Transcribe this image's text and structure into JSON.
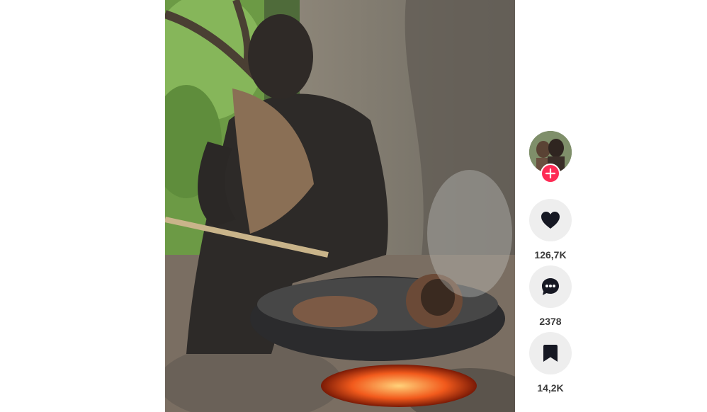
{
  "video": {
    "description_icon": "video-player"
  },
  "sidebar": {
    "avatar_icon": "creator-avatar",
    "follow_icon": "plus-icon",
    "actions": [
      {
        "icon": "heart-icon",
        "count": "126,7K"
      },
      {
        "icon": "comment-icon",
        "count": "2378"
      },
      {
        "icon": "bookmark-icon",
        "count": "14,2K"
      }
    ]
  },
  "colors": {
    "follow_accent": "#fe2c55",
    "action_bg": "#eeeeee",
    "count_text": "#3a3a3a"
  }
}
